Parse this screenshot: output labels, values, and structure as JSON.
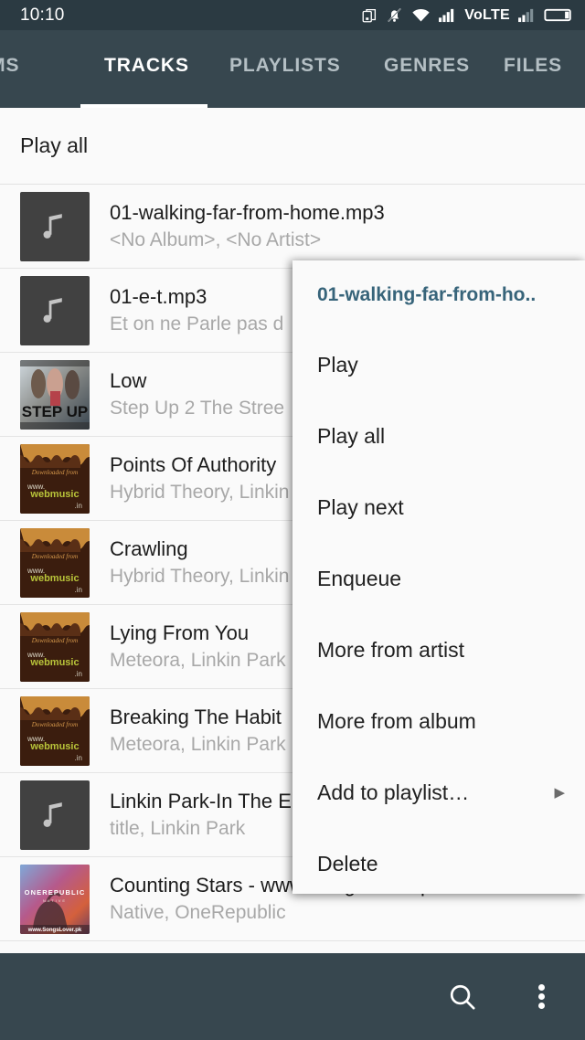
{
  "status_bar": {
    "time": "10:10",
    "volte_label": "VoLTE",
    "icons": [
      "screen-cast-icon",
      "bell-muted-icon",
      "wifi-icon",
      "signal-bars-icon",
      "volte-label",
      "signal-bars-2-icon",
      "battery-icon"
    ]
  },
  "tabs": {
    "items": [
      {
        "label": "BUMS",
        "active": false
      },
      {
        "label": "TRACKS",
        "active": true
      },
      {
        "label": "PLAYLISTS",
        "active": false
      },
      {
        "label": "GENRES",
        "active": false
      },
      {
        "label": "FILES",
        "active": false
      }
    ]
  },
  "list": {
    "play_all_label": "Play all",
    "tracks": [
      {
        "title": "01-walking-far-from-home.mp3",
        "subtitle": "<No Album>, <No Artist>",
        "art": "note"
      },
      {
        "title": "01-e-t.mp3",
        "subtitle": "Et on ne Parle pas d",
        "art": "note"
      },
      {
        "title": "Low",
        "subtitle": "Step Up 2 The Stree",
        "art": "stepup"
      },
      {
        "title": "Points Of Authority",
        "subtitle": "Hybrid Theory, Linkin",
        "art": "webmusic"
      },
      {
        "title": "Crawling",
        "subtitle": "Hybrid Theory, Linkin",
        "art": "webmusic"
      },
      {
        "title": "Lying From You",
        "subtitle": "Meteora, Linkin Park",
        "art": "webmusic"
      },
      {
        "title": "Breaking The Habit",
        "subtitle": "Meteora, Linkin Park",
        "art": "webmusic"
      },
      {
        "title": "Linkin Park-In The E",
        "subtitle": "title, Linkin Park",
        "art": "note"
      },
      {
        "title": "Counting Stars - www.SongsLover.pk",
        "subtitle": "Native, OneRepublic",
        "art": "onerepublic"
      }
    ]
  },
  "context_menu": {
    "header": "01-walking-far-from-ho..",
    "header_color": "#37647a",
    "items": [
      {
        "label": "Play",
        "submenu": false
      },
      {
        "label": "Play all",
        "submenu": false
      },
      {
        "label": "Play next",
        "submenu": false
      },
      {
        "label": "Enqueue",
        "submenu": false
      },
      {
        "label": "More from artist",
        "submenu": false
      },
      {
        "label": "More from album",
        "submenu": false
      },
      {
        "label": "Add to playlist…",
        "submenu": true
      },
      {
        "label": "Delete",
        "submenu": false
      }
    ],
    "submenu_arrow": "▶"
  },
  "bottom_bar": {
    "buttons": [
      {
        "name": "search-icon",
        "label": ""
      },
      {
        "name": "overflow-menu-icon",
        "label": ""
      }
    ]
  },
  "theme": {
    "statusbar_bg": "#2b3a42",
    "appbar_bg": "#37474f",
    "content_bg": "#fafafa",
    "accent": "#37647a",
    "title_color": "#1c1c1c",
    "subtitle_color": "#a8a8a8"
  }
}
